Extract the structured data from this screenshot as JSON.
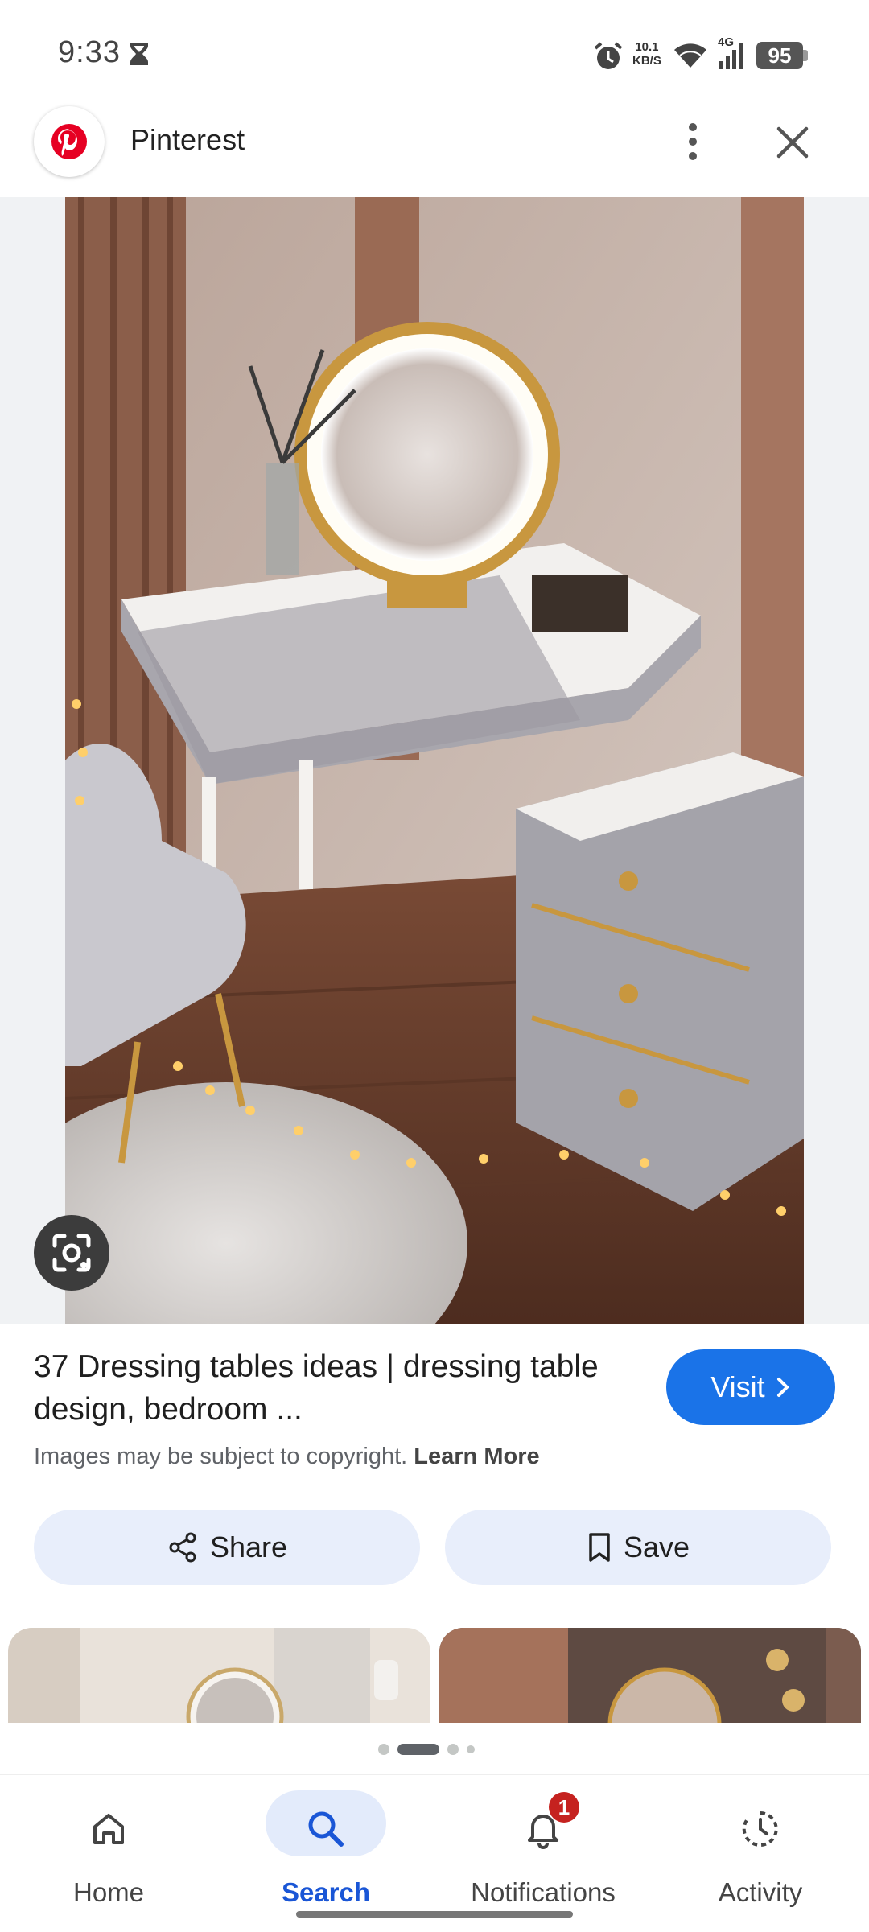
{
  "status_bar": {
    "time": "9:33",
    "net_speed_value": "10.1",
    "net_speed_unit": "KB/S",
    "network_type": "4G",
    "battery": "95"
  },
  "header": {
    "site_name": "Pinterest"
  },
  "result": {
    "title": "37 Dressing tables ideas | dressing table design, bedroom ...",
    "visit_label": "Visit",
    "copyright_text": "Images may be subject to copyright.",
    "learn_more": "Learn More",
    "share_label": "Share",
    "save_label": "Save"
  },
  "bottom_nav": {
    "items": [
      {
        "label": "Home",
        "icon": "home-icon"
      },
      {
        "label": "Search",
        "icon": "search-icon"
      },
      {
        "label": "Notifications",
        "icon": "bell-icon",
        "badge": "1"
      },
      {
        "label": "Activity",
        "icon": "activity-icon"
      }
    ]
  },
  "colors": {
    "accent": "#1a73e8",
    "pinterest_red": "#e60023",
    "chip_bg": "#e8eefb",
    "badge": "#c5221f"
  }
}
